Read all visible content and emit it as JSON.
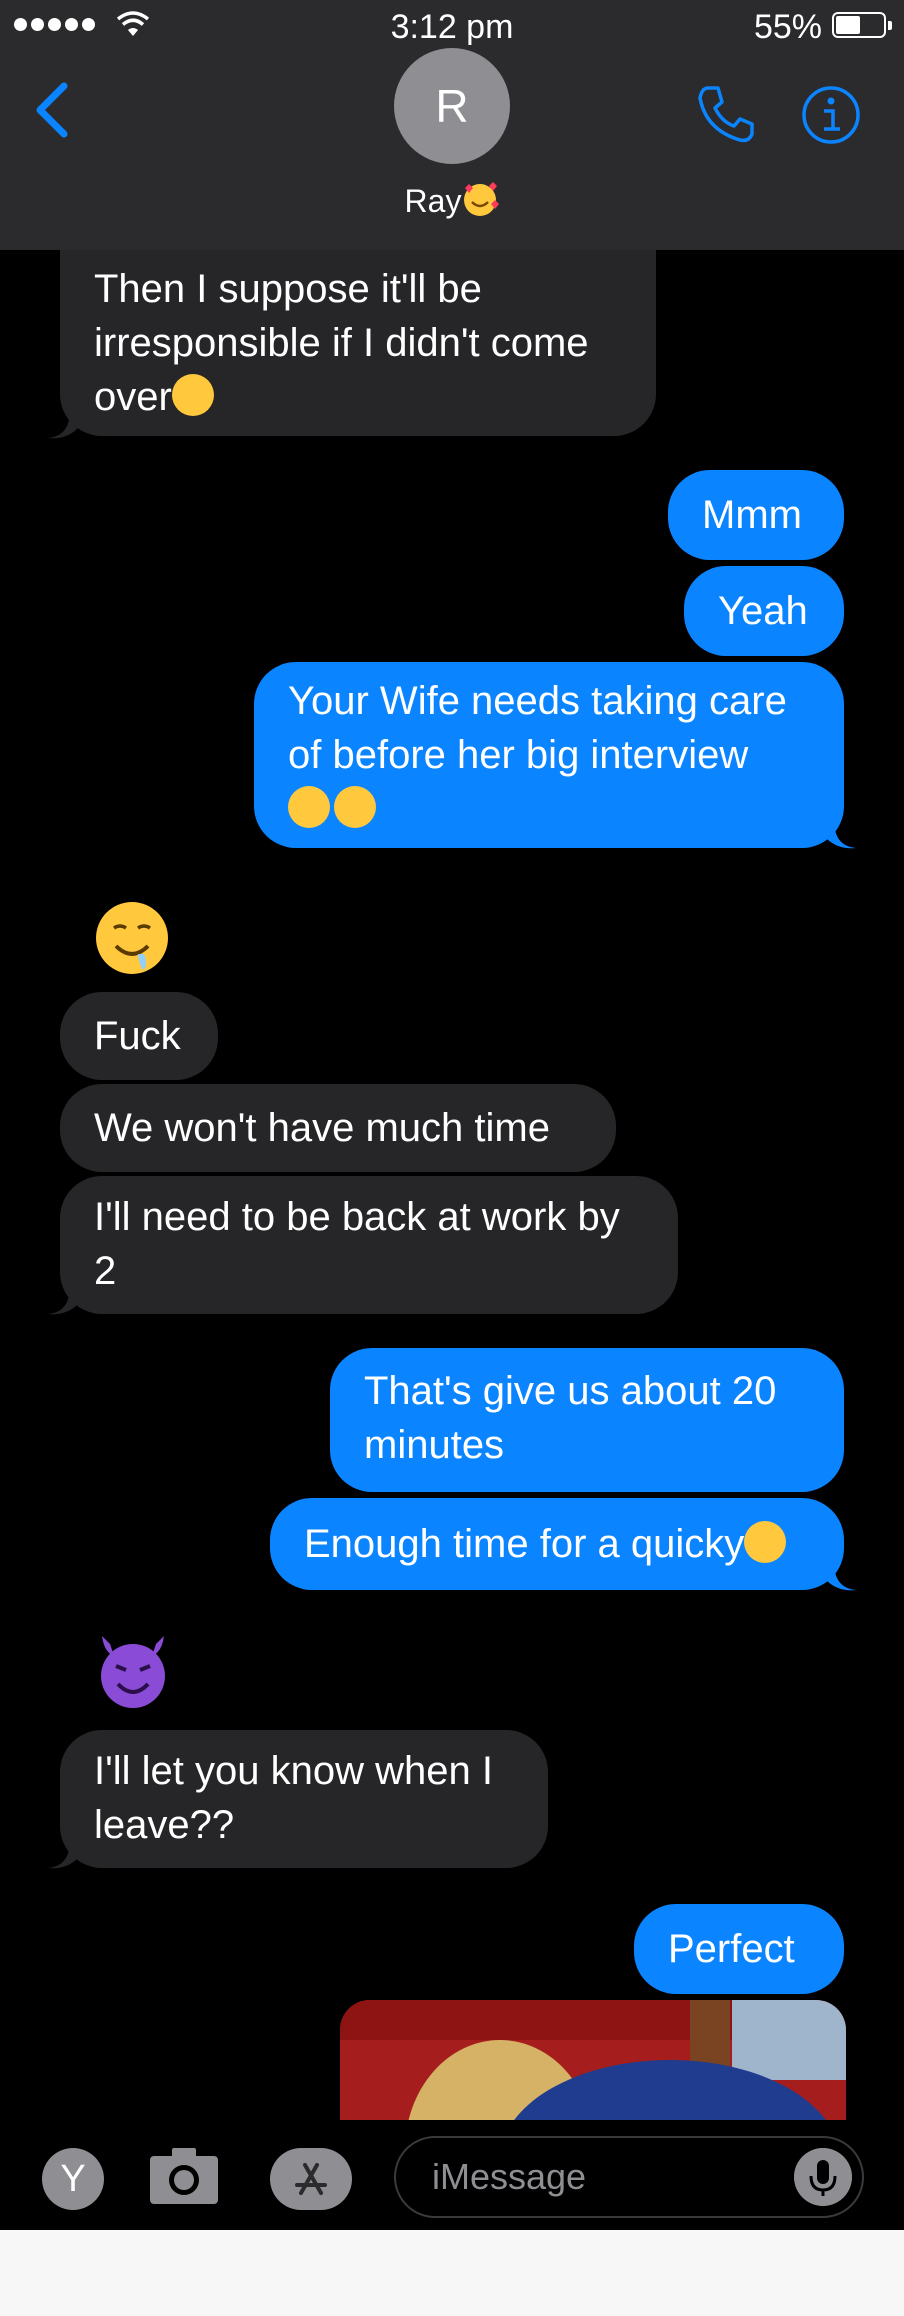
{
  "status_bar": {
    "time": "3:12 pm",
    "battery": "55%"
  },
  "header": {
    "avatar_initial": "R",
    "contact_name": "Ray"
  },
  "messages": [
    {
      "side": "in",
      "text_lines": [
        "Then I suppose it'll be",
        "irresponsible if I didn't come",
        "over"
      ],
      "emoji": "wink"
    },
    {
      "side": "out",
      "text": "Mmm"
    },
    {
      "side": "out",
      "text": "Yeah"
    },
    {
      "side": "out",
      "text_lines": [
        "Your Wife needs taking care",
        "of before her big interview"
      ],
      "emoji": "wink wink"
    },
    {
      "side": "in",
      "emoji_only": "drooling-face"
    },
    {
      "side": "in",
      "text": "Fuck"
    },
    {
      "side": "in",
      "text": "We won't have much time"
    },
    {
      "side": "in",
      "text_lines": [
        "I'll need to be back at work by",
        "2"
      ]
    },
    {
      "side": "out",
      "text_lines": [
        "That's give us about 20",
        "minutes"
      ]
    },
    {
      "side": "out",
      "text": "Enough time for a quicky",
      "emoji": "wink"
    },
    {
      "side": "in",
      "emoji_only": "smiling-devil"
    },
    {
      "side": "in",
      "text_lines": [
        "I'll let you know when I",
        "leave??"
      ]
    },
    {
      "side": "out",
      "text": "Perfect"
    },
    {
      "side": "out",
      "attachment": "photo"
    }
  ],
  "input": {
    "placeholder": "iMessage",
    "apps_button": "Y"
  },
  "colors": {
    "outgoing": "#0a84ff",
    "incoming": "#262628",
    "header": "#2b2b2d"
  }
}
